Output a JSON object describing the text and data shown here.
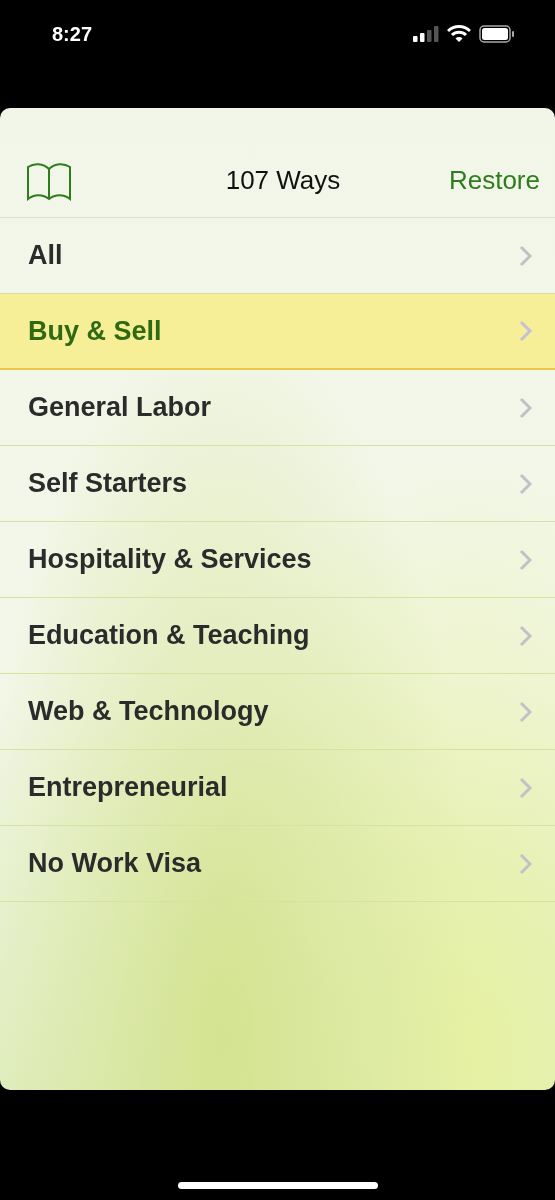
{
  "status_bar": {
    "time": "8:27"
  },
  "header": {
    "title": "107 Ways",
    "action": "Restore"
  },
  "categories": [
    {
      "label": "All",
      "selected": false
    },
    {
      "label": "Buy & Sell",
      "selected": true
    },
    {
      "label": "General Labor",
      "selected": false
    },
    {
      "label": "Self Starters",
      "selected": false
    },
    {
      "label": "Hospitality & Services",
      "selected": false
    },
    {
      "label": "Education & Teaching",
      "selected": false
    },
    {
      "label": "Web & Technology",
      "selected": false
    },
    {
      "label": "Entrepreneurial",
      "selected": false
    },
    {
      "label": "No Work Visa",
      "selected": false
    }
  ]
}
